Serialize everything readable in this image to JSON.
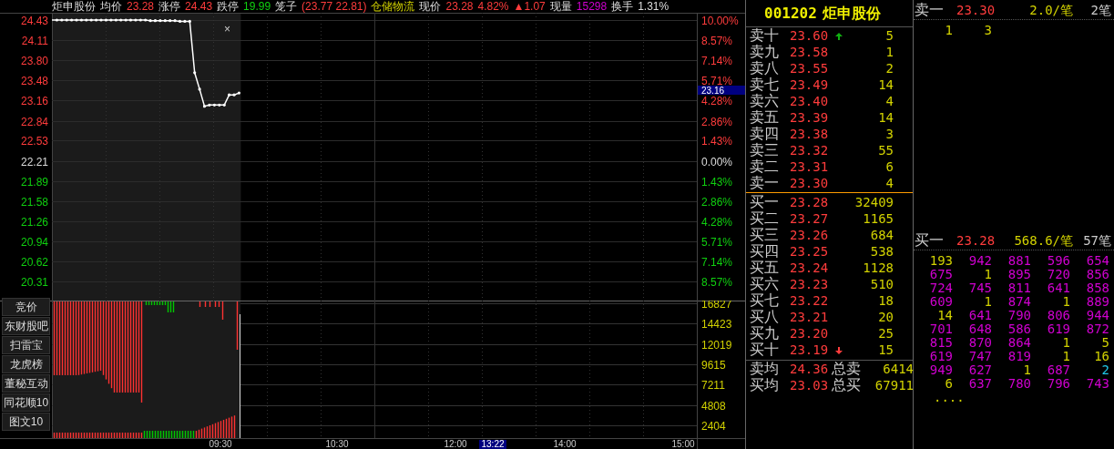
{
  "quote_bar": {
    "name": "炬申股份",
    "items": [
      {
        "label": "均价",
        "values": [
          {
            "text": "23.28",
            "color": "#ff3c3c"
          }
        ]
      },
      {
        "label": "涨停",
        "values": [
          {
            "text": "24.43",
            "color": "#ff3c3c"
          }
        ]
      },
      {
        "label": "跌停",
        "values": [
          {
            "text": "19.99",
            "color": "#10d010"
          }
        ]
      },
      {
        "label": "笼子",
        "values": [
          {
            "text": "(23.77 22.81)",
            "color": "#ff3c3c"
          }
        ]
      },
      {
        "label": "仓储物流",
        "kind": "sector"
      },
      {
        "label": "现价",
        "values": [
          {
            "text": "23.28",
            "color": "#ff3c3c"
          },
          {
            "text": "4.82%",
            "color": "#ff3c3c"
          },
          {
            "text": "▲1.07",
            "color": "#ff3c3c"
          }
        ]
      },
      {
        "label": "现量",
        "values": [
          {
            "text": "15298",
            "color": "#d000d0"
          }
        ]
      },
      {
        "label": "换手",
        "values": [
          {
            "text": "1.31%",
            "color": "#dddddd"
          }
        ]
      }
    ]
  },
  "price_chart": {
    "close_mark": "×",
    "chart_data": {
      "type": "line",
      "grid": true,
      "ylim": [
        20.31,
        24.43
      ],
      "yticks": [
        20.31,
        20.62,
        20.94,
        21.26,
        21.58,
        21.89,
        22.21,
        22.53,
        22.84,
        23.16,
        23.48,
        {
          "value": 23.8,
          "label": "23.80"
        },
        24.11,
        24.43
      ],
      "series": [
        {
          "color": "#ffffff",
          "values": [
            24.43,
            24.43,
            24.43,
            24.43,
            24.43,
            24.43,
            24.43,
            24.43,
            24.43,
            24.43,
            24.43,
            24.43,
            24.43,
            24.43,
            24.43,
            24.43,
            24.43,
            24.43,
            24.43,
            24.43,
            24.42,
            24.42,
            24.42,
            24.42,
            24.42,
            24.42,
            24.41,
            24.41,
            24.41,
            23.6,
            23.34,
            23.07,
            23.09,
            23.09,
            23.09,
            23.09,
            23.25,
            23.25,
            23.28,
            null,
            null,
            null,
            null,
            null,
            null,
            null,
            null,
            null,
            null,
            null,
            null,
            null,
            null,
            null,
            null,
            null,
            null,
            null,
            null,
            null,
            null,
            null,
            null,
            null,
            null,
            null,
            null,
            null,
            null,
            null,
            null,
            null,
            null,
            null,
            null,
            null,
            null,
            null,
            null,
            null,
            null,
            null,
            null,
            null,
            null,
            null,
            null,
            null,
            null,
            null,
            null,
            null,
            null,
            null,
            null,
            null,
            null,
            null,
            null,
            null,
            null,
            null,
            null,
            null,
            null,
            null,
            null,
            null,
            null,
            null,
            null,
            null,
            null,
            null,
            null,
            null,
            null,
            null,
            null,
            null,
            null,
            null,
            null,
            null,
            null,
            null,
            null,
            null,
            null,
            null,
            null,
            null
          ]
        }
      ]
    },
    "percent_axis": [
      {
        "text": "10.00%",
        "color": "#ff3c3c"
      },
      {
        "text": "8.57%",
        "color": "#ff3c3c"
      },
      {
        "text": "7.14%",
        "color": "#ff3c3c"
      },
      {
        "text": "5.71%",
        "color": "#ff3c3c"
      },
      {
        "text": "4.28%",
        "color": "#ff3c3c"
      },
      {
        "text": "2.86%",
        "color": "#ff3c3c"
      },
      {
        "text": "1.43%",
        "color": "#ff3c3c"
      },
      {
        "text": "0.00%",
        "color": "#dddddd"
      },
      {
        "text": "1.43%",
        "color": "#10d010"
      },
      {
        "text": "2.86%",
        "color": "#10d010"
      },
      {
        "text": "4.28%",
        "color": "#10d010"
      },
      {
        "text": "5.71%",
        "color": "#10d010"
      },
      {
        "text": "7.14%",
        "color": "#10d010"
      },
      {
        "text": "8.57%",
        "color": "#10d010"
      }
    ],
    "cursor_price": "23.16"
  },
  "volume_axis": [
    "16827",
    "14423",
    "12019",
    "9615",
    "7211",
    "4808",
    "2404"
  ],
  "time_axis": {
    "labels": [
      "09:30",
      "10:30",
      "12:00",
      "14:00",
      "15:00"
    ],
    "cursor": "13:22"
  },
  "side_buttons": [
    "竞价",
    "东财股吧",
    "扫雷宝",
    "龙虎榜",
    "董秘互动",
    "同花顺10",
    "图文10"
  ],
  "order_book": {
    "code": "001202",
    "name": "炬申股份",
    "asks": [
      {
        "label": "卖十",
        "price": "23.60",
        "volume": "5",
        "kind": "arrow_up"
      },
      {
        "label": "卖九",
        "price": "23.58",
        "volume": "1",
        "kind": "plain"
      },
      {
        "label": "卖八",
        "price": "23.55",
        "volume": "2",
        "kind": "plain"
      },
      {
        "label": "卖七",
        "price": "23.49",
        "volume": "14",
        "kind": "plain"
      },
      {
        "label": "卖六",
        "price": "23.40",
        "volume": "4",
        "kind": "plain"
      },
      {
        "label": "卖五",
        "price": "23.39",
        "volume": "14",
        "kind": "plain"
      },
      {
        "label": "卖四",
        "price": "23.38",
        "volume": "3",
        "kind": "plain"
      },
      {
        "label": "卖三",
        "price": "23.32",
        "volume": "55",
        "kind": "plain"
      },
      {
        "label": "卖二",
        "price": "23.31",
        "volume": "6",
        "kind": "plain"
      },
      {
        "label": "卖一",
        "price": "23.30",
        "volume": "4",
        "kind": "plain"
      }
    ],
    "bids": [
      {
        "label": "买一",
        "price": "23.28",
        "volume": "32409",
        "kind": "plain"
      },
      {
        "label": "买二",
        "price": "23.27",
        "volume": "1165",
        "kind": "plain"
      },
      {
        "label": "买三",
        "price": "23.26",
        "volume": "684",
        "kind": "plain"
      },
      {
        "label": "买四",
        "price": "23.25",
        "volume": "538",
        "kind": "plain"
      },
      {
        "label": "买五",
        "price": "23.24",
        "volume": "1128",
        "kind": "plain"
      },
      {
        "label": "买六",
        "price": "23.23",
        "volume": "510",
        "kind": "plain"
      },
      {
        "label": "买七",
        "price": "23.22",
        "volume": "18",
        "kind": "plain"
      },
      {
        "label": "买八",
        "price": "23.21",
        "volume": "20",
        "kind": "plain"
      },
      {
        "label": "买九",
        "price": "23.20",
        "volume": "25",
        "kind": "plain"
      },
      {
        "label": "买十",
        "price": "23.19",
        "volume": "15",
        "kind": "arrow_down"
      }
    ],
    "summary": [
      {
        "label": "卖均",
        "price": "24.36",
        "total_label": "总卖",
        "total": "6414"
      },
      {
        "label": "买均",
        "price": "23.03",
        "total_label": "总买",
        "total": "67911"
      }
    ]
  },
  "queue_panel": [
    {
      "label": "卖一",
      "price": "23.30",
      "average": "2.0/笔",
      "count": "2笔",
      "orders": [
        {
          "text": "1",
          "color": "#d2d200"
        },
        {
          "text": "3",
          "color": "#d2d200"
        }
      ]
    },
    {
      "label": "买一",
      "price": "23.28",
      "average": "568.6/笔",
      "count": "57笔",
      "more": "....",
      "orders": [
        {
          "text": "193",
          "color": "#d2d200"
        },
        {
          "text": "942",
          "color": "#d000d0"
        },
        {
          "text": "881",
          "color": "#d000d0"
        },
        {
          "text": "596",
          "color": "#d000d0"
        },
        {
          "text": "654",
          "color": "#d000d0"
        },
        {
          "text": "675",
          "color": "#d000d0"
        },
        {
          "text": "1",
          "color": "#d2d200"
        },
        {
          "text": "895",
          "color": "#d000d0"
        },
        {
          "text": "720",
          "color": "#d000d0"
        },
        {
          "text": "856",
          "color": "#d000d0"
        },
        {
          "text": "724",
          "color": "#d000d0"
        },
        {
          "text": "745",
          "color": "#d000d0"
        },
        {
          "text": "811",
          "color": "#d000d0"
        },
        {
          "text": "641",
          "color": "#d000d0"
        },
        {
          "text": "858",
          "color": "#d000d0"
        },
        {
          "text": "609",
          "color": "#d000d0"
        },
        {
          "text": "1",
          "color": "#d2d200"
        },
        {
          "text": "874",
          "color": "#d000d0"
        },
        {
          "text": "1",
          "color": "#d2d200"
        },
        {
          "text": "889",
          "color": "#d000d0"
        },
        {
          "text": "14",
          "color": "#d2d200"
        },
        {
          "text": "641",
          "color": "#d000d0"
        },
        {
          "text": "790",
          "color": "#d000d0"
        },
        {
          "text": "806",
          "color": "#d000d0"
        },
        {
          "text": "944",
          "color": "#d000d0"
        },
        {
          "text": "701",
          "color": "#d000d0"
        },
        {
          "text": "648",
          "color": "#d000d0"
        },
        {
          "text": "586",
          "color": "#d000d0"
        },
        {
          "text": "619",
          "color": "#d000d0"
        },
        {
          "text": "872",
          "color": "#d000d0"
        },
        {
          "text": "815",
          "color": "#d000d0"
        },
        {
          "text": "870",
          "color": "#d000d0"
        },
        {
          "text": "864",
          "color": "#d000d0"
        },
        {
          "text": "1",
          "color": "#d2d200"
        },
        {
          "text": "5",
          "color": "#d2d200"
        },
        {
          "text": "619",
          "color": "#d000d0"
        },
        {
          "text": "747",
          "color": "#d000d0"
        },
        {
          "text": "819",
          "color": "#d000d0"
        },
        {
          "text": "1",
          "color": "#d2d200"
        },
        {
          "text": "16",
          "color": "#d2d200"
        },
        {
          "text": "949",
          "color": "#d000d0"
        },
        {
          "text": "627",
          "color": "#d000d0"
        },
        {
          "text": "1",
          "color": "#d2d200"
        },
        {
          "text": "687",
          "color": "#d000d0"
        },
        {
          "text": "2",
          "color": "#20c8e8"
        },
        {
          "text": "6",
          "color": "#d2d200"
        },
        {
          "text": "637",
          "color": "#d000d0"
        },
        {
          "text": "780",
          "color": "#d000d0"
        },
        {
          "text": "796",
          "color": "#d000d0"
        },
        {
          "text": "743",
          "color": "#d000d0"
        }
      ]
    }
  ]
}
